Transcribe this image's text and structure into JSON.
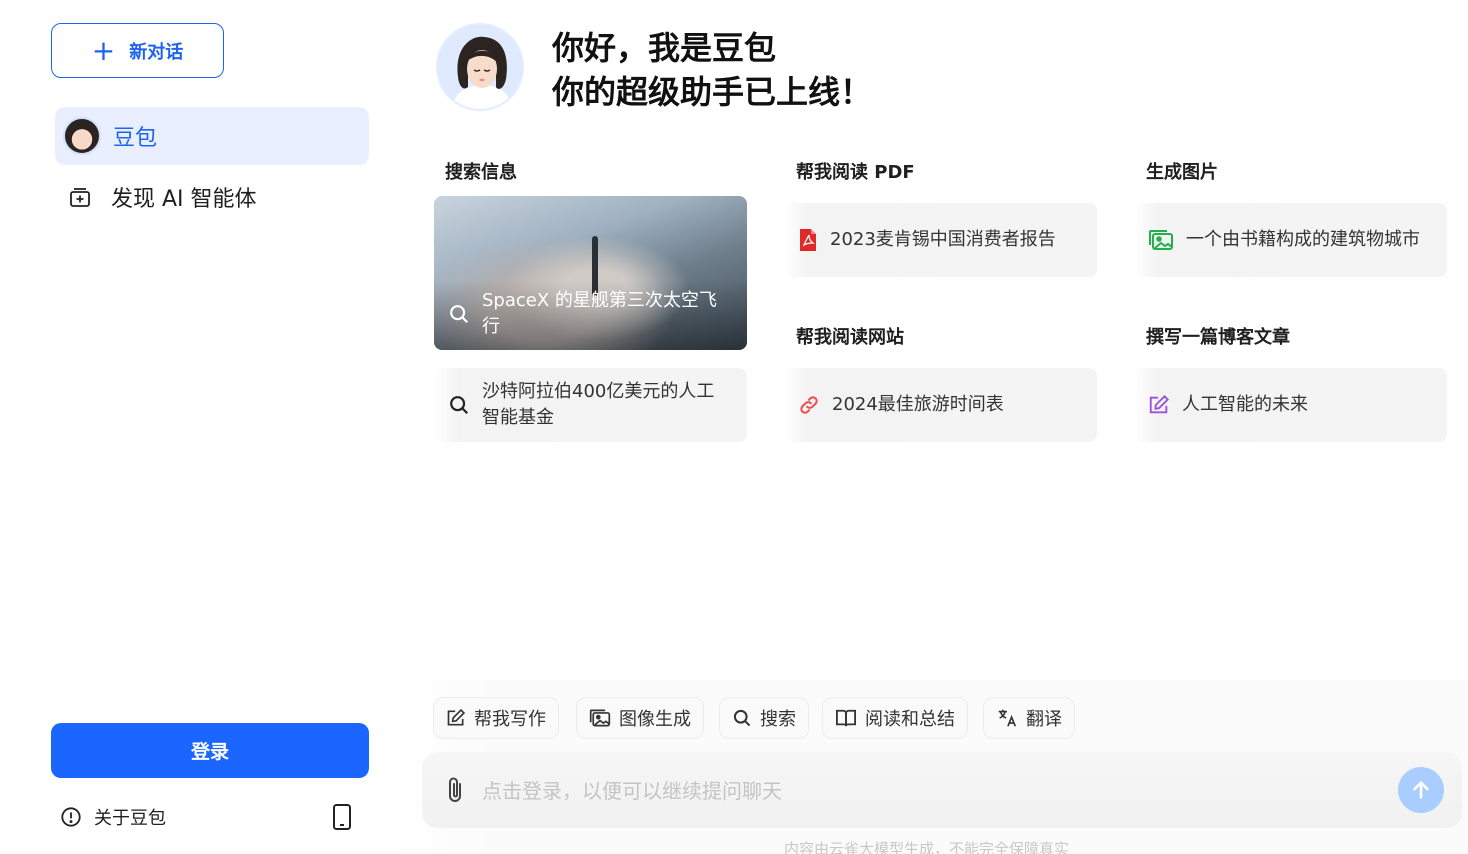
{
  "sidebar": {
    "new_chat_label": "新对话",
    "items": [
      {
        "label": "豆包",
        "active": true
      },
      {
        "label": "发现 AI 智能体",
        "active": false
      }
    ],
    "login_label": "登录",
    "about_label": "关于豆包"
  },
  "hero": {
    "line1": "你好，我是豆包",
    "line2": "你的超级助手已上线！"
  },
  "sections": {
    "search": {
      "title": "搜索信息",
      "image_card_text": "SpaceX 的星舰第三次太空飞行",
      "card_text": "沙特阿拉伯400亿美元的人工智能基金"
    },
    "read_pdf": {
      "title": "帮我阅读 PDF",
      "card_text": "2023麦肯锡中国消费者报告"
    },
    "gen_image": {
      "title": "生成图片",
      "card_text": "一个由书籍构成的建筑物城市"
    },
    "read_web": {
      "title": "帮我阅读网站",
      "card_text": "2024最佳旅游时间表"
    },
    "blog": {
      "title": "撰写一篇博客文章",
      "card_text": "人工智能的未来"
    }
  },
  "tools": [
    {
      "label": "帮我写作",
      "icon": "edit-icon"
    },
    {
      "label": "图像生成",
      "icon": "image-icon"
    },
    {
      "label": "搜索",
      "icon": "search-icon"
    },
    {
      "label": "阅读和总结",
      "icon": "book-icon"
    },
    {
      "label": "翻译",
      "icon": "translate-icon"
    }
  ],
  "input": {
    "placeholder": "点击登录，以便可以继续提问聊天"
  },
  "disclaimer": "内容由云雀大模型生成，不能完全保障真实",
  "colors": {
    "accent": "#1a66ff",
    "active_bg": "#e9efff",
    "pdf": "#e02a2a",
    "image": "#22b04b",
    "link": "#ee4d4d",
    "edit": "#9b51e0"
  }
}
